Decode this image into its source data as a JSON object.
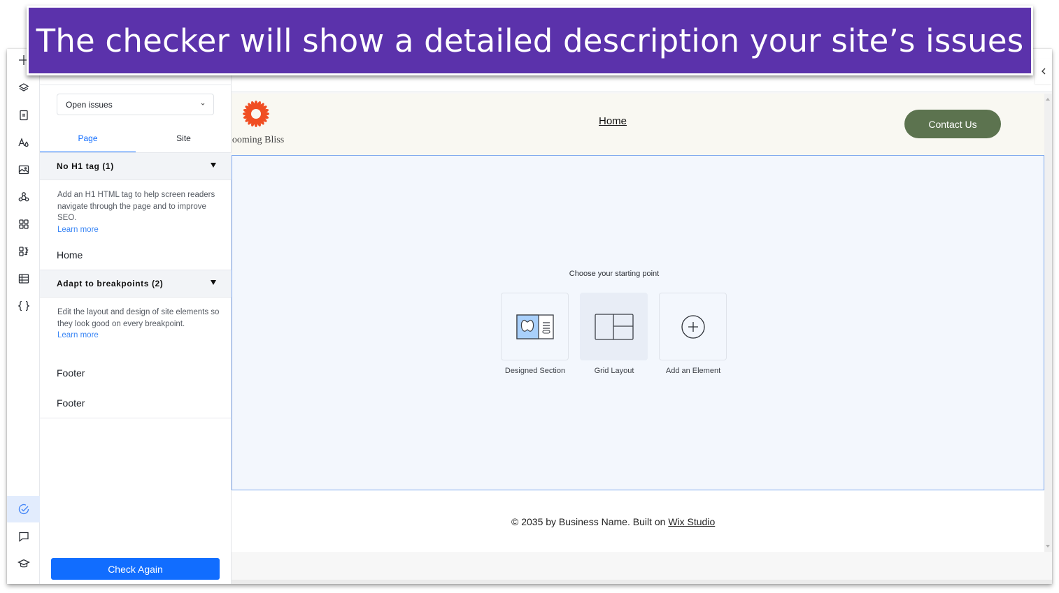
{
  "banner": {
    "text": "The checker will show a detailed description your site’s issues"
  },
  "rail": {
    "items": [
      {
        "name": "add",
        "icon": "plus-icon"
      },
      {
        "name": "layers",
        "icon": "layers-icon"
      },
      {
        "name": "pages",
        "icon": "page-icon"
      },
      {
        "name": "design",
        "icon": "text-color-icon"
      },
      {
        "name": "media",
        "icon": "image-icon"
      },
      {
        "name": "cms",
        "icon": "connections-icon"
      },
      {
        "name": "apps",
        "icon": "apps-grid-icon"
      },
      {
        "name": "business-apps",
        "icon": "puzzle-icon"
      },
      {
        "name": "tables",
        "icon": "table-icon"
      },
      {
        "name": "code",
        "icon": "code-braces-icon"
      },
      {
        "name": "site-checker",
        "icon": "check-circle-icon",
        "active": true
      },
      {
        "name": "comments",
        "icon": "comment-icon"
      },
      {
        "name": "learn",
        "icon": "graduation-cap-icon"
      }
    ]
  },
  "panel": {
    "filter": {
      "value": "Open issues"
    },
    "tabs": [
      {
        "label": "Page",
        "active": true
      },
      {
        "label": "Site",
        "active": false
      }
    ],
    "issues": [
      {
        "title": "No H1 tag (1)",
        "description": "Add an H1 HTML tag to help screen readers navigate through the page and to improve SEO.",
        "learn_more": "Learn more",
        "items": [
          "Home"
        ]
      },
      {
        "title": "Adapt to breakpoints (2)",
        "description": "Edit the layout and design of site elements so they look good on every breakpoint.",
        "learn_more": "Learn more",
        "items": [
          "Footer",
          "Footer"
        ]
      }
    ],
    "check_again": "Check Again"
  },
  "site": {
    "logo_text": "looming Bliss",
    "nav_home": "Home",
    "contact": "Contact Us",
    "choose_title": "Choose your starting point",
    "options": [
      {
        "label": "Designed Section",
        "icon": "designed-section-icon"
      },
      {
        "label": "Grid Layout",
        "icon": "grid-layout-icon"
      },
      {
        "label": "Add an Element",
        "icon": "add-circle-icon"
      }
    ],
    "footer_prefix": "© 2035 by Business Name. Built on ",
    "footer_link": "Wix Studio"
  },
  "colors": {
    "banner": "#5b32ab",
    "primary": "#116dff",
    "contact_button": "#5c734f",
    "logo": "#f04e23",
    "header_bg": "#f9f8f2",
    "section_bg": "#f3f7fd"
  }
}
